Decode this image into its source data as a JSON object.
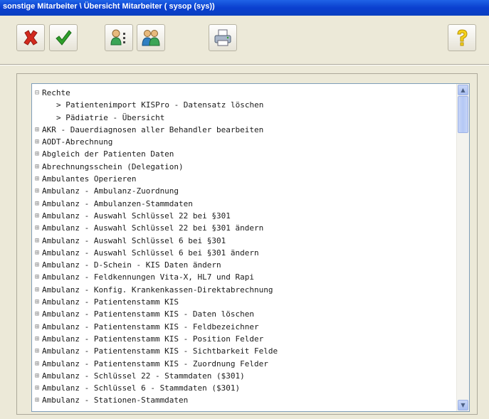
{
  "window": {
    "title": "sonstige Mitarbeiter \\ Übersicht Mitarbeiter ( sysop (sys))"
  },
  "toolbar": {
    "buttons": [
      {
        "name": "delete",
        "icon": "red-x-icon"
      },
      {
        "name": "confirm",
        "icon": "green-check-icon"
      },
      {
        "name": "user-details",
        "icon": "user-list-icon"
      },
      {
        "name": "user-group",
        "icon": "users-group-icon"
      },
      {
        "name": "print",
        "icon": "printer-icon"
      },
      {
        "name": "help",
        "icon": "question-mark-icon"
      }
    ]
  },
  "tree": {
    "items": [
      {
        "label": "Rechte",
        "level": 0,
        "toggle": "⊟"
      },
      {
        "label": "> Patientenimport KISPro - Datensatz löschen",
        "level": 1,
        "toggle": ""
      },
      {
        "label": "> Pädiatrie - Übersicht",
        "level": 1,
        "toggle": ""
      },
      {
        "label": "AKR - Dauerdiagnosen aller Behandler bearbeiten",
        "level": 0,
        "toggle": "⊞"
      },
      {
        "label": "AODT-Abrechnung",
        "level": 0,
        "toggle": "⊞"
      },
      {
        "label": "Abgleich der Patienten Daten",
        "level": 0,
        "toggle": "⊞"
      },
      {
        "label": "Abrechnungsschein (Delegation)",
        "level": 0,
        "toggle": "⊞"
      },
      {
        "label": "Ambulantes Operieren",
        "level": 0,
        "toggle": "⊞"
      },
      {
        "label": "Ambulanz - Ambulanz-Zuordnung",
        "level": 0,
        "toggle": "⊞"
      },
      {
        "label": "Ambulanz - Ambulanzen-Stammdaten",
        "level": 0,
        "toggle": "⊞"
      },
      {
        "label": "Ambulanz - Auswahl Schlüssel 22 bei §301",
        "level": 0,
        "toggle": "⊞"
      },
      {
        "label": "Ambulanz - Auswahl Schlüssel 22 bei §301 ändern",
        "level": 0,
        "toggle": "⊞"
      },
      {
        "label": "Ambulanz - Auswahl Schlüssel 6 bei §301",
        "level": 0,
        "toggle": "⊞"
      },
      {
        "label": "Ambulanz - Auswahl Schlüssel 6 bei §301 ändern",
        "level": 0,
        "toggle": "⊞"
      },
      {
        "label": "Ambulanz - D-Schein - KIS Daten ändern",
        "level": 0,
        "toggle": "⊞"
      },
      {
        "label": "Ambulanz - Feldkennungen Vita-X, HL7 und Rapi",
        "level": 0,
        "toggle": "⊞"
      },
      {
        "label": "Ambulanz - Konfig. Krankenkassen-Direktabrechnung",
        "level": 0,
        "toggle": "⊞"
      },
      {
        "label": "Ambulanz - Patientenstamm KIS",
        "level": 0,
        "toggle": "⊞"
      },
      {
        "label": "Ambulanz - Patientenstamm KIS - Daten löschen",
        "level": 0,
        "toggle": "⊞"
      },
      {
        "label": "Ambulanz - Patientenstamm KIS - Feldbezeichner",
        "level": 0,
        "toggle": "⊞"
      },
      {
        "label": "Ambulanz - Patientenstamm KIS - Position Felder",
        "level": 0,
        "toggle": "⊞"
      },
      {
        "label": "Ambulanz - Patientenstamm KIS - Sichtbarkeit Felde",
        "level": 0,
        "toggle": "⊞"
      },
      {
        "label": "Ambulanz - Patientenstamm KIS - Zuordnung Felder",
        "level": 0,
        "toggle": "⊞"
      },
      {
        "label": "Ambulanz - Schlüssel 22 - Stammdaten ($301)",
        "level": 0,
        "toggle": "⊞"
      },
      {
        "label": "Ambulanz - Schlüssel 6 - Stammdaten ($301)",
        "level": 0,
        "toggle": "⊞"
      },
      {
        "label": "Ambulanz - Stationen-Stammdaten",
        "level": 0,
        "toggle": "⊞"
      }
    ]
  },
  "colors": {
    "titlebar": "#0A3FCF",
    "window_bg": "#ECE9D8",
    "tree_bg": "#FFFFFF",
    "tree_border": "#7F9DB9"
  }
}
